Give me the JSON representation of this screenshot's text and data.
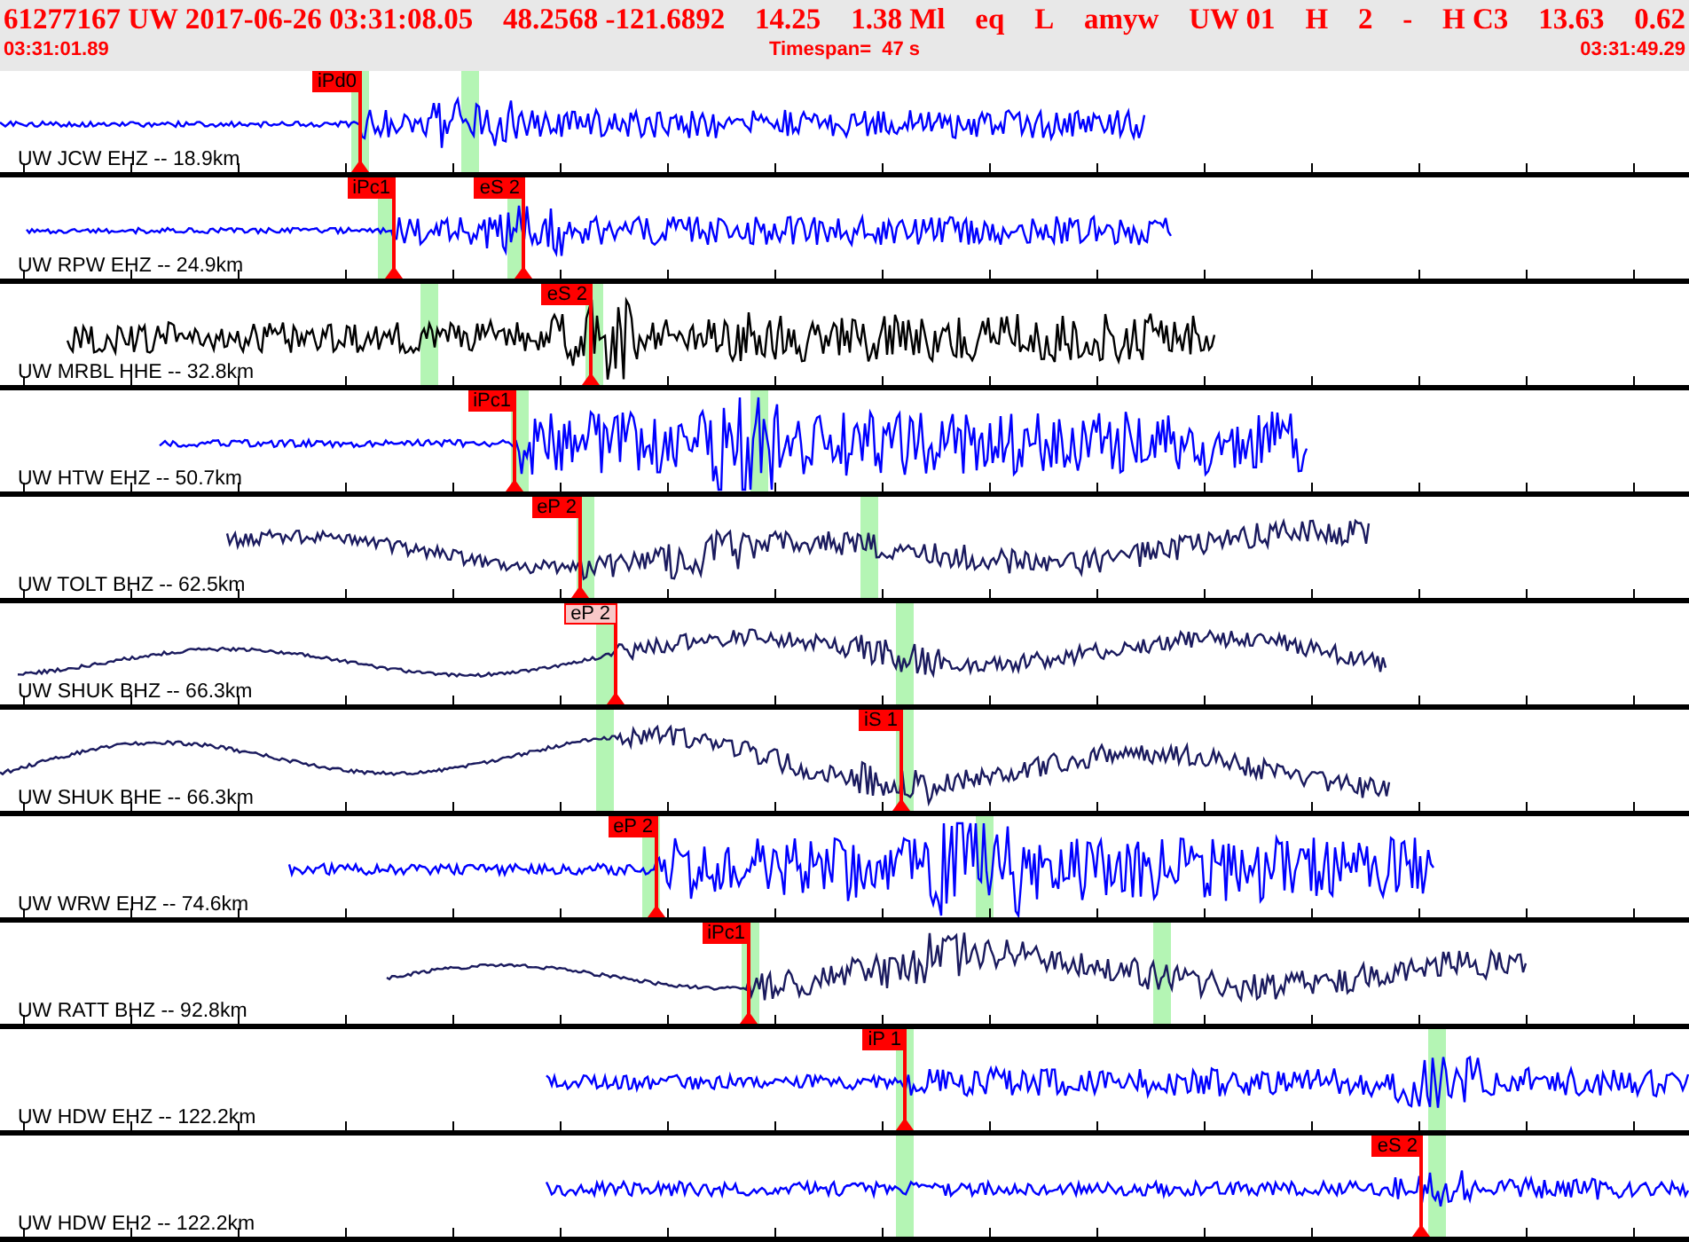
{
  "header": {
    "fields": [
      "61277167 UW 2017-06-26 03:31:08.05",
      "48.2568 -121.6892",
      "14.25",
      "1.38 Ml",
      "eq",
      "L",
      "amyw",
      "UW 01",
      "H",
      "2",
      "-",
      "H C3",
      "13.63",
      "0.62"
    ]
  },
  "timeline": {
    "start": "03:31:01.89",
    "timespan": "Timespan=  47 s",
    "end": "03:31:49.29"
  },
  "traces": [
    {
      "label": "UW JCW EHZ -- 18.9km",
      "color": "#0000ff",
      "picks": [
        {
          "label": "iPd0",
          "kind": "filled"
        }
      ]
    },
    {
      "label": "UW RPW EHZ -- 24.9km",
      "color": "#0000ff",
      "picks": [
        {
          "label": "iPc1",
          "kind": "filled"
        },
        {
          "label": "eS 2",
          "kind": "filled"
        }
      ]
    },
    {
      "label": "UW MRBL HHE -- 32.8km",
      "color": "#000000",
      "picks": [
        {
          "label": "eS 2",
          "kind": "filled"
        }
      ]
    },
    {
      "label": "UW HTW EHZ -- 50.7km",
      "color": "#0000ff",
      "picks": [
        {
          "label": "iPc1",
          "kind": "filled"
        }
      ]
    },
    {
      "label": "UW TOLT BHZ -- 62.5km",
      "color": "#1a1a5e",
      "picks": [
        {
          "label": "eP 2",
          "kind": "filled"
        }
      ]
    },
    {
      "label": "UW SHUK BHZ -- 66.3km",
      "color": "#1a1a5e",
      "picks": [
        {
          "label": "eP 2",
          "kind": "outline"
        }
      ]
    },
    {
      "label": "UW SHUK BHE -- 66.3km",
      "color": "#1a1a5e",
      "picks": [
        {
          "label": "iS 1",
          "kind": "filled"
        }
      ]
    },
    {
      "label": "UW WRW EHZ -- 74.6km",
      "color": "#0000ff",
      "picks": [
        {
          "label": "eP 2",
          "kind": "filled"
        }
      ]
    },
    {
      "label": "UW RATT BHZ -- 92.8km",
      "color": "#1a1a5e",
      "picks": [
        {
          "label": "iPc1",
          "kind": "filled"
        }
      ]
    },
    {
      "label": "UW HDW EHZ -- 122.2km",
      "color": "#0000ff",
      "picks": [
        {
          "label": "iP 1",
          "kind": "filled"
        }
      ]
    },
    {
      "label": "UW HDW EH2 -- 122.2km",
      "color": "#0000ff",
      "picks": [
        {
          "label": "eS 2",
          "kind": "filled"
        }
      ]
    }
  ]
}
